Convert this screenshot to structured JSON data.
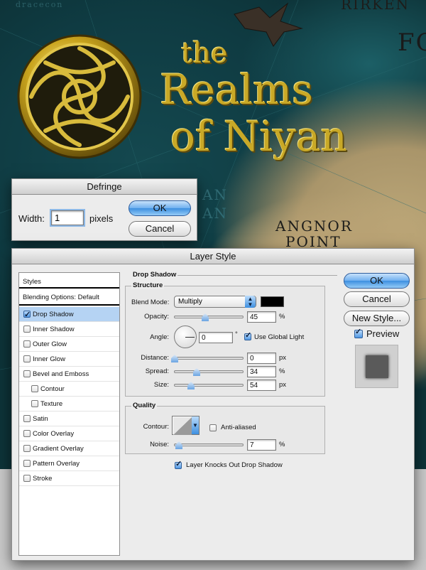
{
  "map": {
    "labels": [
      "dracecon",
      "RIRKEN",
      "FOR",
      "AN",
      "AN",
      "ANGNOR",
      "POINT"
    ],
    "title_art": {
      "line1": "the",
      "line2": "Realms",
      "line3": "of Niyan"
    }
  },
  "defringe": {
    "title": "Defringe",
    "width_label": "Width:",
    "width_value": "1",
    "unit_label": "pixels",
    "ok_label": "OK",
    "cancel_label": "Cancel"
  },
  "layer_style": {
    "title": "Layer Style",
    "styles_list": {
      "header": "Styles",
      "blending": "Blending Options: Default",
      "items": [
        {
          "label": "Drop Shadow",
          "checked": true,
          "selected": true
        },
        {
          "label": "Inner Shadow",
          "checked": false
        },
        {
          "label": "Outer Glow",
          "checked": false
        },
        {
          "label": "Inner Glow",
          "checked": false
        },
        {
          "label": "Bevel and Emboss",
          "checked": false
        },
        {
          "label": "Contour",
          "checked": false
        },
        {
          "label": "Texture",
          "checked": false
        },
        {
          "label": "Satin",
          "checked": false
        },
        {
          "label": "Color Overlay",
          "checked": false
        },
        {
          "label": "Gradient Overlay",
          "checked": false
        },
        {
          "label": "Pattern Overlay",
          "checked": false
        },
        {
          "label": "Stroke",
          "checked": false
        }
      ]
    },
    "drop_shadow": {
      "section_title": "Drop Shadow",
      "structure": {
        "title": "Structure",
        "blend_mode_label": "Blend Mode:",
        "blend_mode_value": "Multiply",
        "color": "#000000",
        "opacity_label": "Opacity:",
        "opacity_value": "45",
        "opacity_unit": "%",
        "angle_label": "Angle:",
        "angle_value": "0",
        "angle_unit": "°",
        "global_light_label": "Use Global Light",
        "distance_label": "Distance:",
        "distance_value": "0",
        "distance_unit": "px",
        "spread_label": "Spread:",
        "spread_value": "34",
        "spread_unit": "%",
        "size_label": "Size:",
        "size_value": "54",
        "size_unit": "px"
      },
      "quality": {
        "title": "Quality",
        "contour_label": "Contour:",
        "antialiased_label": "Anti-aliased",
        "noise_label": "Noise:",
        "noise_value": "7",
        "noise_unit": "%"
      },
      "knockout_label": "Layer Knocks Out Drop Shadow"
    },
    "buttons": {
      "ok": "OK",
      "cancel": "Cancel",
      "new_style": "New Style...",
      "preview": "Preview"
    }
  }
}
